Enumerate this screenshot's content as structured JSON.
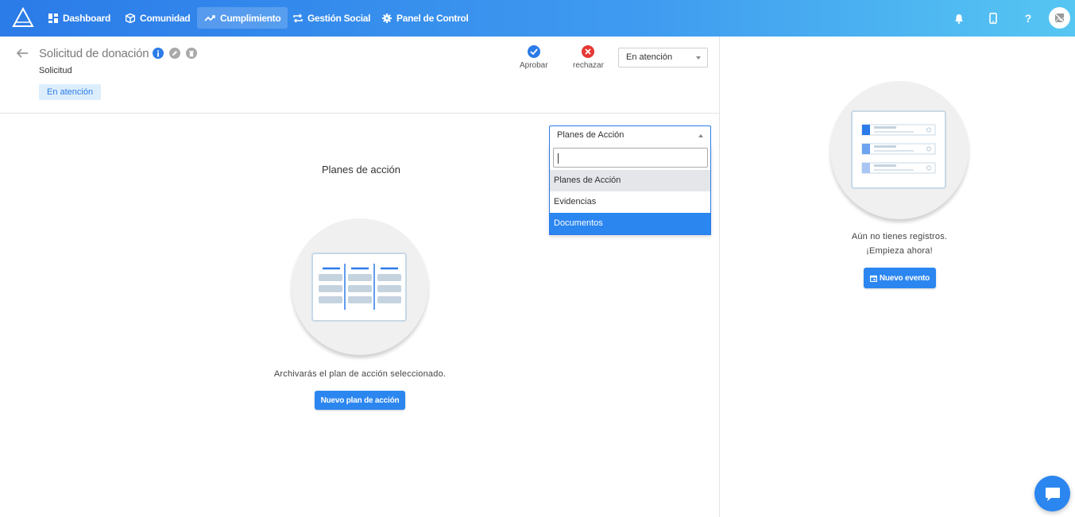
{
  "nav": {
    "items": [
      {
        "label": "Dashboard",
        "icon": "dashboard-icon"
      },
      {
        "label": "Comunidad",
        "icon": "cube-icon"
      },
      {
        "label": "Cumplimiento",
        "icon": "trend-icon"
      },
      {
        "label": "Gestión Social",
        "icon": "repeat-icon"
      },
      {
        "label": "Panel de Control",
        "icon": "gear-icon"
      }
    ],
    "active": "Cumplimiento",
    "help": "?"
  },
  "record": {
    "title": "Solicitud de donación",
    "subtitle": "Solicitud",
    "status_chip": "En atención"
  },
  "actions": {
    "approve_label": "Aprobar",
    "reject_label": "rechazar",
    "status_value": "En atención"
  },
  "section": {
    "title": "Planes de acción",
    "dropdown_value": "Planes de Acción",
    "options": [
      "Planes de Acción",
      "Evidencias",
      "Documentos"
    ],
    "empty_text": "Archivarás el plan de acción seleccionado.",
    "new_button": "Nuevo plan de acción"
  },
  "events": {
    "empty_line1": "Aún no tienes registros.",
    "empty_line2": "¡Empieza ahora!",
    "new_button": "Nuevo evento"
  },
  "colors": {
    "primary": "#2b86f0",
    "approve": "#2b7be8",
    "reject": "#e53935",
    "chip_bg": "#dceefc"
  }
}
